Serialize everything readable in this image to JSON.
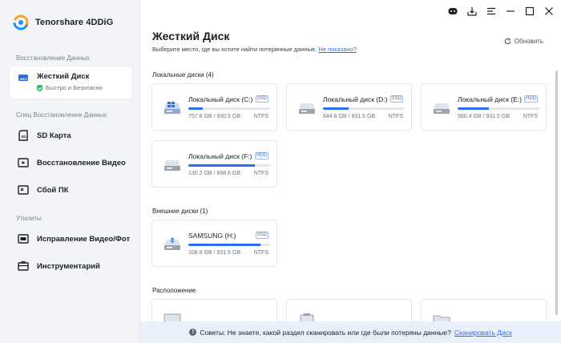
{
  "app": {
    "name": "Tenorshare 4DDiG"
  },
  "sidebar": {
    "sections": [
      "Восстановление Данных",
      "Спец Восстановление Данных",
      "Утилиты"
    ],
    "active": {
      "label": "Жесткий Диск",
      "sub": "Быстро и Безопасно"
    },
    "items": [
      {
        "label": "SD Карта",
        "icon": "sd-card-icon"
      },
      {
        "label": "Восстановление Видео",
        "icon": "video-icon"
      },
      {
        "label": "Сбой ПК",
        "icon": "pc-crash-icon"
      },
      {
        "label": "Исправление Видео/Фот",
        "icon": "repair-icon"
      },
      {
        "label": "Инструментарий",
        "icon": "toolbox-icon"
      }
    ]
  },
  "main": {
    "title": "Жесткий Диск",
    "subtitle": "Выберите место, где вы хотите найти потерянные данные.",
    "not_shown_link": "Не показано?",
    "refresh_label": "Обновить",
    "local_title": "Локальные диски (4)",
    "external_title": "Внешние диски (1)",
    "location_title": "Расположение",
    "local_disks": [
      {
        "name": "Локальный диск (C:)",
        "tag": "SSD",
        "size": "757.6 GB / 930.5 GB",
        "fs": "NTFS",
        "fill_pct": 18
      },
      {
        "name": "Локальный диск (D:)",
        "tag": "SSD",
        "size": "644.6 GB / 931.5 GB",
        "fs": "NTFS",
        "fill_pct": 31
      },
      {
        "name": "Локальный диск (E:)",
        "tag": "HDD",
        "size": "580.4 GB / 931.5 GB",
        "fs": "NTFS",
        "fill_pct": 38
      },
      {
        "name": "Локальный диск (F:)",
        "tag": "HDD",
        "size": "130.2 GB / 698.6 GB",
        "fs": "NTFS",
        "fill_pct": 81
      }
    ],
    "external_disks": [
      {
        "name": "SAMSUNG (H:)",
        "tag": "SSD",
        "size": "108.8 GB / 931.5 GB",
        "fs": "NTFS",
        "fill_pct": 88
      }
    ],
    "tip_text": "Советы: Не знаете, какой раздел сканировать или где были потеряны данные?",
    "tip_link": "Сканировать Диск"
  },
  "colors": {
    "accent": "#2a6ef3",
    "success": "#2fbf71"
  }
}
